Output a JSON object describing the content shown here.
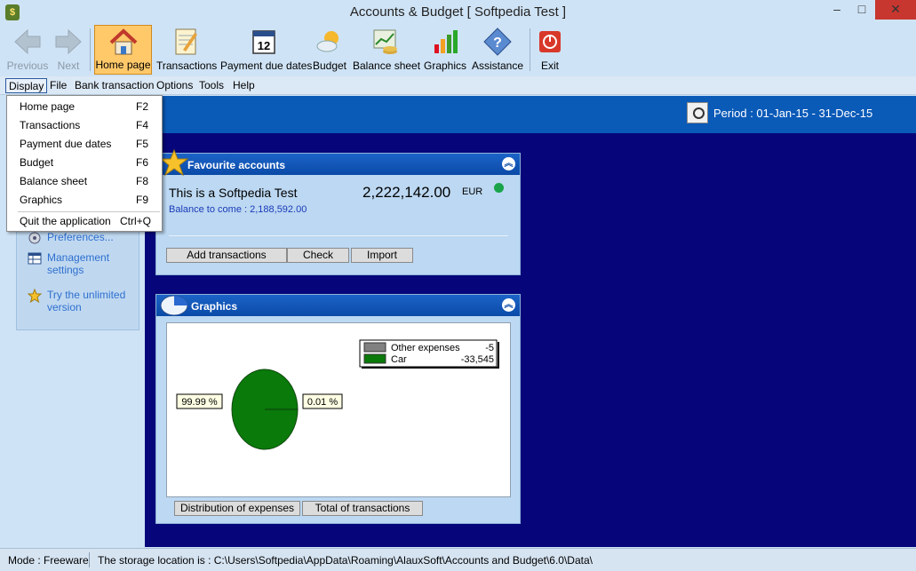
{
  "window": {
    "title": "Accounts & Budget [ Softpedia Test ]",
    "icon_label": "$",
    "minimize": "–",
    "maximize": "□",
    "close": "✕"
  },
  "toolbar": {
    "previous": "Previous",
    "next": "Next",
    "home_page": "Home page",
    "transactions": "Transactions",
    "payment_due_dates": "Payment due dates",
    "calendar_day": "12",
    "budget": "Budget",
    "balance_sheet": "Balance sheet",
    "graphics": "Graphics",
    "assistance": "Assistance",
    "exit": "Exit"
  },
  "menubar": {
    "display": "Display",
    "file": "File",
    "bank_transaction": "Bank transaction",
    "options": "Options",
    "tools": "Tools",
    "help": "Help"
  },
  "dropdown": [
    {
      "label": "Home page",
      "key": "F2"
    },
    {
      "label": "Transactions",
      "key": "F4"
    },
    {
      "label": "Payment due dates",
      "key": "F5"
    },
    {
      "label": "Budget",
      "key": "F6"
    },
    {
      "label": "Balance sheet",
      "key": "F8"
    },
    {
      "label": "Graphics",
      "key": "F9"
    },
    {
      "label": "Quit the application",
      "key": "Ctrl+Q"
    }
  ],
  "period": "Period : 01-Jan-15 - 31-Dec-15",
  "sidebar": {
    "preferences": "Preferences...",
    "management_settings": "Management settings",
    "try_unlimited": "Try the unlimited version"
  },
  "favourite": {
    "header": "Favourite accounts",
    "account_name": "This is a Softpedia Test",
    "amount": "2,222,142.00",
    "currency": "EUR",
    "balance_to_come": "Balance to come : 2,188,592.00",
    "status_color": "#1aa34a",
    "add_transactions": "Add transactions",
    "check": "Check",
    "import": "Import"
  },
  "graphics_panel": {
    "header": "Graphics",
    "distribution_button": "Distribution of expenses",
    "total_button": "Total of transactions"
  },
  "chart_data": {
    "type": "pie",
    "labels": [
      "Other expenses",
      "Car"
    ],
    "values": [
      -5,
      -33545
    ],
    "value_labels": [
      "-5",
      "-33,545"
    ],
    "colors": [
      "#808080",
      "#0a7a0a"
    ],
    "slice_labels": [
      "0.01 %",
      "99.99 %"
    ],
    "legend": "top-right"
  },
  "statusbar": {
    "mode": "Mode : Freeware",
    "storage": "The storage location is : C:\\Users\\Softpedia\\AppData\\Roaming\\AlauxSoft\\Accounts and Budget\\6.0\\Data\\"
  }
}
